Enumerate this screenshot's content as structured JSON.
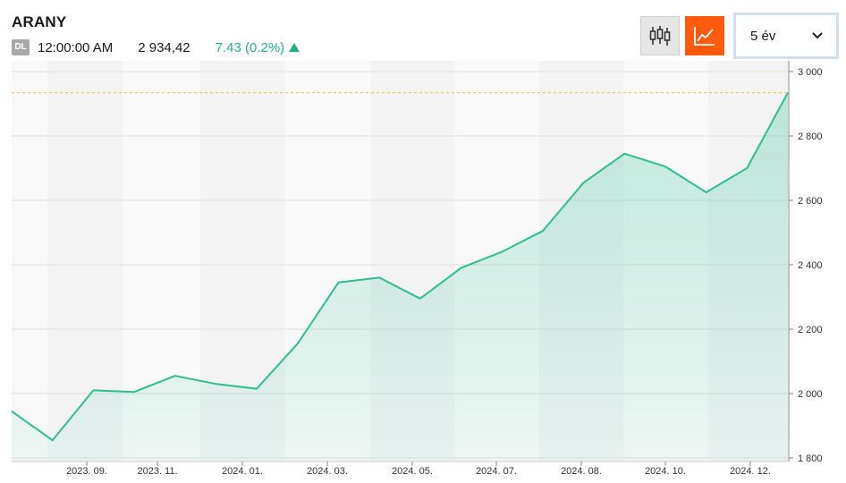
{
  "header": {
    "title": "ARANY",
    "badge": "DL",
    "time": "12:00:00 AM",
    "price": "2 934,42",
    "change": "7.43 (0.2%)"
  },
  "toolbar": {
    "candle_icon": "candlestick-icon",
    "line_icon": "line-chart-icon",
    "range_value": "5 év",
    "dropdown_icon": "chevron-down-icon"
  },
  "colors": {
    "line": "#2bbf92",
    "accent_orange": "#ff5a0e",
    "positive": "#22b38a",
    "reference_line": "#f0c030"
  },
  "chart_data": {
    "type": "area",
    "x": [
      "2023-07-31",
      "2023-08-31",
      "2023-09-30",
      "2023-10-31",
      "2023-11-30",
      "2023-12-31",
      "2024-01-31",
      "2024-02-29",
      "2024-03-31",
      "2024-04-30",
      "2024-05-31",
      "2024-06-30",
      "2024-07-31",
      "2024-08-31",
      "2024-09-30",
      "2024-10-31",
      "2024-11-30",
      "2024-12-31",
      "2025-01-31"
    ],
    "values": [
      1945,
      1855,
      2010,
      2005,
      2055,
      2030,
      2015,
      2155,
      2345,
      2360,
      2295,
      2390,
      2440,
      2505,
      2655,
      2745,
      2705,
      2625,
      2700,
      2934.42
    ],
    "x_tick_labels": [
      "2023. 09.",
      "2023. 11.",
      "2024. 01.",
      "2024. 03.",
      "2024. 05.",
      "2024. 07.",
      "2024. 08.",
      "2024. 10.",
      "2024. 12."
    ],
    "y_tick_labels": [
      "3 000",
      "2 800",
      "2 600",
      "2 400",
      "2 200",
      "2 000",
      "1 800"
    ],
    "y_ticks": [
      3000,
      2800,
      2600,
      2400,
      2200,
      2000,
      1800
    ],
    "ylim": [
      1800,
      3000
    ],
    "reference_value": 2934.42,
    "grid": true
  }
}
